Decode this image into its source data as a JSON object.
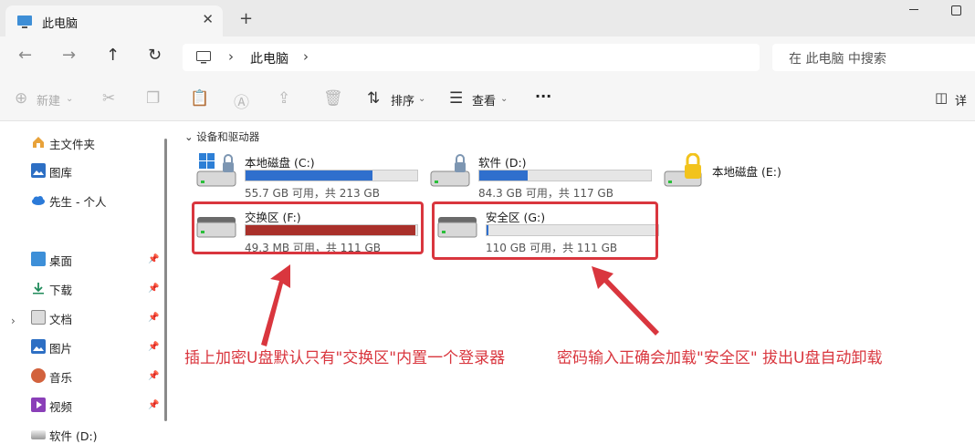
{
  "tab": {
    "title": "此电脑",
    "close": "✕",
    "new": "+"
  },
  "address": {
    "crumb": "此电脑",
    "sep": "›"
  },
  "search": {
    "placeholder": "在 此电脑 中搜索"
  },
  "toolbar": {
    "new_label": "新建",
    "sort_label": "排序",
    "view_label": "查看",
    "more": "···",
    "details_label": "详"
  },
  "sidebar": {
    "items": [
      {
        "label": "主文件夹",
        "icon": "home-icon",
        "pinned": false
      },
      {
        "label": "图库",
        "icon": "gallery-icon",
        "pinned": false
      },
      {
        "label": "先生 - 个人",
        "icon": "cloud-icon",
        "pinned": false
      },
      {
        "label": "桌面",
        "icon": "desktop-icon",
        "pinned": true
      },
      {
        "label": "下载",
        "icon": "download-icon",
        "pinned": true
      },
      {
        "label": "文档",
        "icon": "document-icon",
        "pinned": true
      },
      {
        "label": "图片",
        "icon": "pictures-icon",
        "pinned": true
      },
      {
        "label": "音乐",
        "icon": "music-icon",
        "pinned": true
      },
      {
        "label": "视频",
        "icon": "video-icon",
        "pinned": true
      },
      {
        "label": "软件 (D:)",
        "icon": "drive-icon",
        "pinned": false
      }
    ]
  },
  "main": {
    "group_label": "设备和驱动器",
    "drives": [
      {
        "name": "本地磁盘 (C:)",
        "info": "55.7 GB 可用，共 213 GB",
        "used": 0.74,
        "color": "#2f6fcd"
      },
      {
        "name": "软件 (D:)",
        "info": "84.3 GB 可用，共 117 GB",
        "used": 0.28,
        "color": "#2f6fcd"
      },
      {
        "name": "本地磁盘 (E:)",
        "info": "",
        "used": null,
        "color": ""
      },
      {
        "name": "交换区 (F:)",
        "info": "49.3 MB 可用，共 111 GB",
        "used": 0.99,
        "color": "#a9302a"
      },
      {
        "name": "安全区 (G:)",
        "info": "110 GB 可用，共 111 GB",
        "used": 0.01,
        "color": "#2f6fcd"
      }
    ]
  },
  "annotations": {
    "left": "插上加密U盘默认只有\"交换区\"内置一个登录器",
    "right": "密码输入正确会加载\"安全区\" 拔出U盘自动卸载"
  },
  "colors": {
    "accent_red": "#d9363e",
    "bar_blue": "#2f6fcd",
    "bar_red": "#a9302a"
  }
}
